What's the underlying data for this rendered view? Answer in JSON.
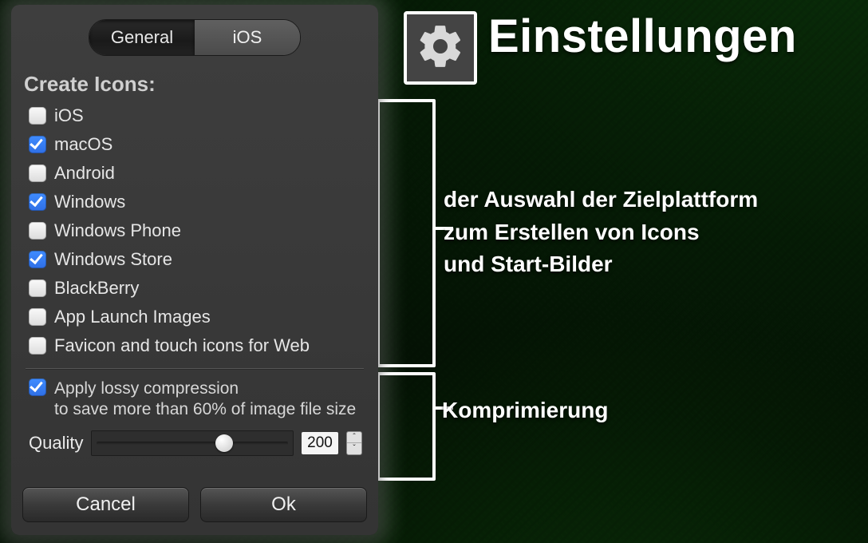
{
  "title": "Einstellungen",
  "annotations": {
    "platforms_line1": "der Auswahl der Zielplattform",
    "platforms_line2": "zum Erstellen von Icons",
    "platforms_line3": "und Start-Bilder",
    "compression": "Komprimierung"
  },
  "tabs": {
    "general": "General",
    "ios": "iOS",
    "active": "general"
  },
  "section_title": "Create Icons:",
  "checkboxes": [
    {
      "label": "iOS",
      "checked": false
    },
    {
      "label": "macOS",
      "checked": true
    },
    {
      "label": "Android",
      "checked": false
    },
    {
      "label": "Windows",
      "checked": true
    },
    {
      "label": "Windows Phone",
      "checked": false
    },
    {
      "label": "Windows Store",
      "checked": true
    },
    {
      "label": "BlackBerry",
      "checked": false
    },
    {
      "label": "App Launch Images",
      "checked": false
    },
    {
      "label": "Favicon and touch icons for Web",
      "checked": false
    }
  ],
  "compression": {
    "checked": true,
    "line1": "Apply lossy compression",
    "line2": "to save more than 60% of image file size"
  },
  "quality": {
    "label": "Quality",
    "value": "200",
    "min": 0,
    "max": 300,
    "thumb_percent": 66
  },
  "buttons": {
    "cancel": "Cancel",
    "ok": "Ok"
  }
}
